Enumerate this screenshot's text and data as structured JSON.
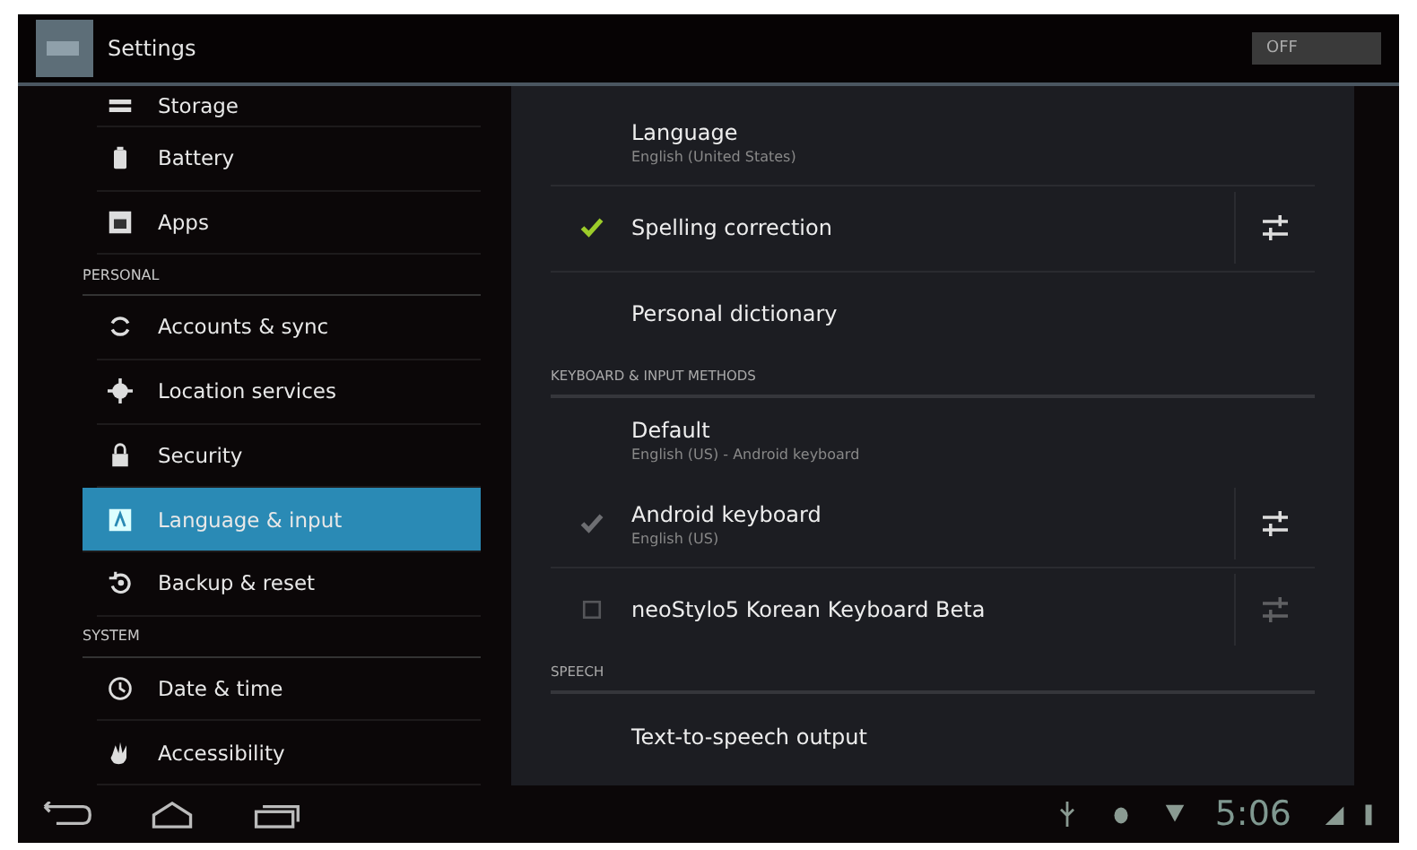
{
  "header": {
    "title": "Settings",
    "switch": {
      "label": "OFF",
      "on": false
    }
  },
  "sidebar": {
    "items": [
      {
        "kind": "item",
        "label": "Storage",
        "selected": false
      },
      {
        "kind": "item",
        "label": "Battery",
        "selected": false
      },
      {
        "kind": "item",
        "label": "Apps",
        "selected": false
      },
      {
        "kind": "header",
        "label": "PERSONAL"
      },
      {
        "kind": "item",
        "label": "Accounts & sync",
        "selected": false
      },
      {
        "kind": "item",
        "label": "Location services",
        "selected": false
      },
      {
        "kind": "item",
        "label": "Security",
        "selected": false
      },
      {
        "kind": "item",
        "label": "Language & input",
        "selected": true
      },
      {
        "kind": "item",
        "label": "Backup & reset",
        "selected": false
      },
      {
        "kind": "header",
        "label": "SYSTEM"
      },
      {
        "kind": "item",
        "label": "Date & time",
        "selected": false
      },
      {
        "kind": "item",
        "label": "Accessibility",
        "selected": false
      }
    ]
  },
  "panel": {
    "rows": [
      {
        "kind": "item",
        "title": "Language",
        "subtitle": "English (United States)"
      },
      {
        "kind": "check",
        "title": "Spelling correction",
        "checked": true,
        "disabled": false
      },
      {
        "kind": "item",
        "title": "Personal dictionary"
      },
      {
        "kind": "header",
        "title": "KEYBOARD & INPUT METHODS"
      },
      {
        "kind": "item",
        "title": "Default",
        "subtitle": "English (US) - Android keyboard"
      },
      {
        "kind": "check",
        "title": "Android keyboard",
        "subtitle": "English (US)",
        "checked": true,
        "disabled": true
      },
      {
        "kind": "check",
        "title": "neoStylo5 Korean Keyboard Beta",
        "checked": false,
        "disabled": false
      },
      {
        "kind": "header",
        "title": "SPEECH"
      },
      {
        "kind": "item",
        "title": "Text-to-speech output"
      }
    ]
  },
  "status_bar": {
    "time": "5:06"
  }
}
